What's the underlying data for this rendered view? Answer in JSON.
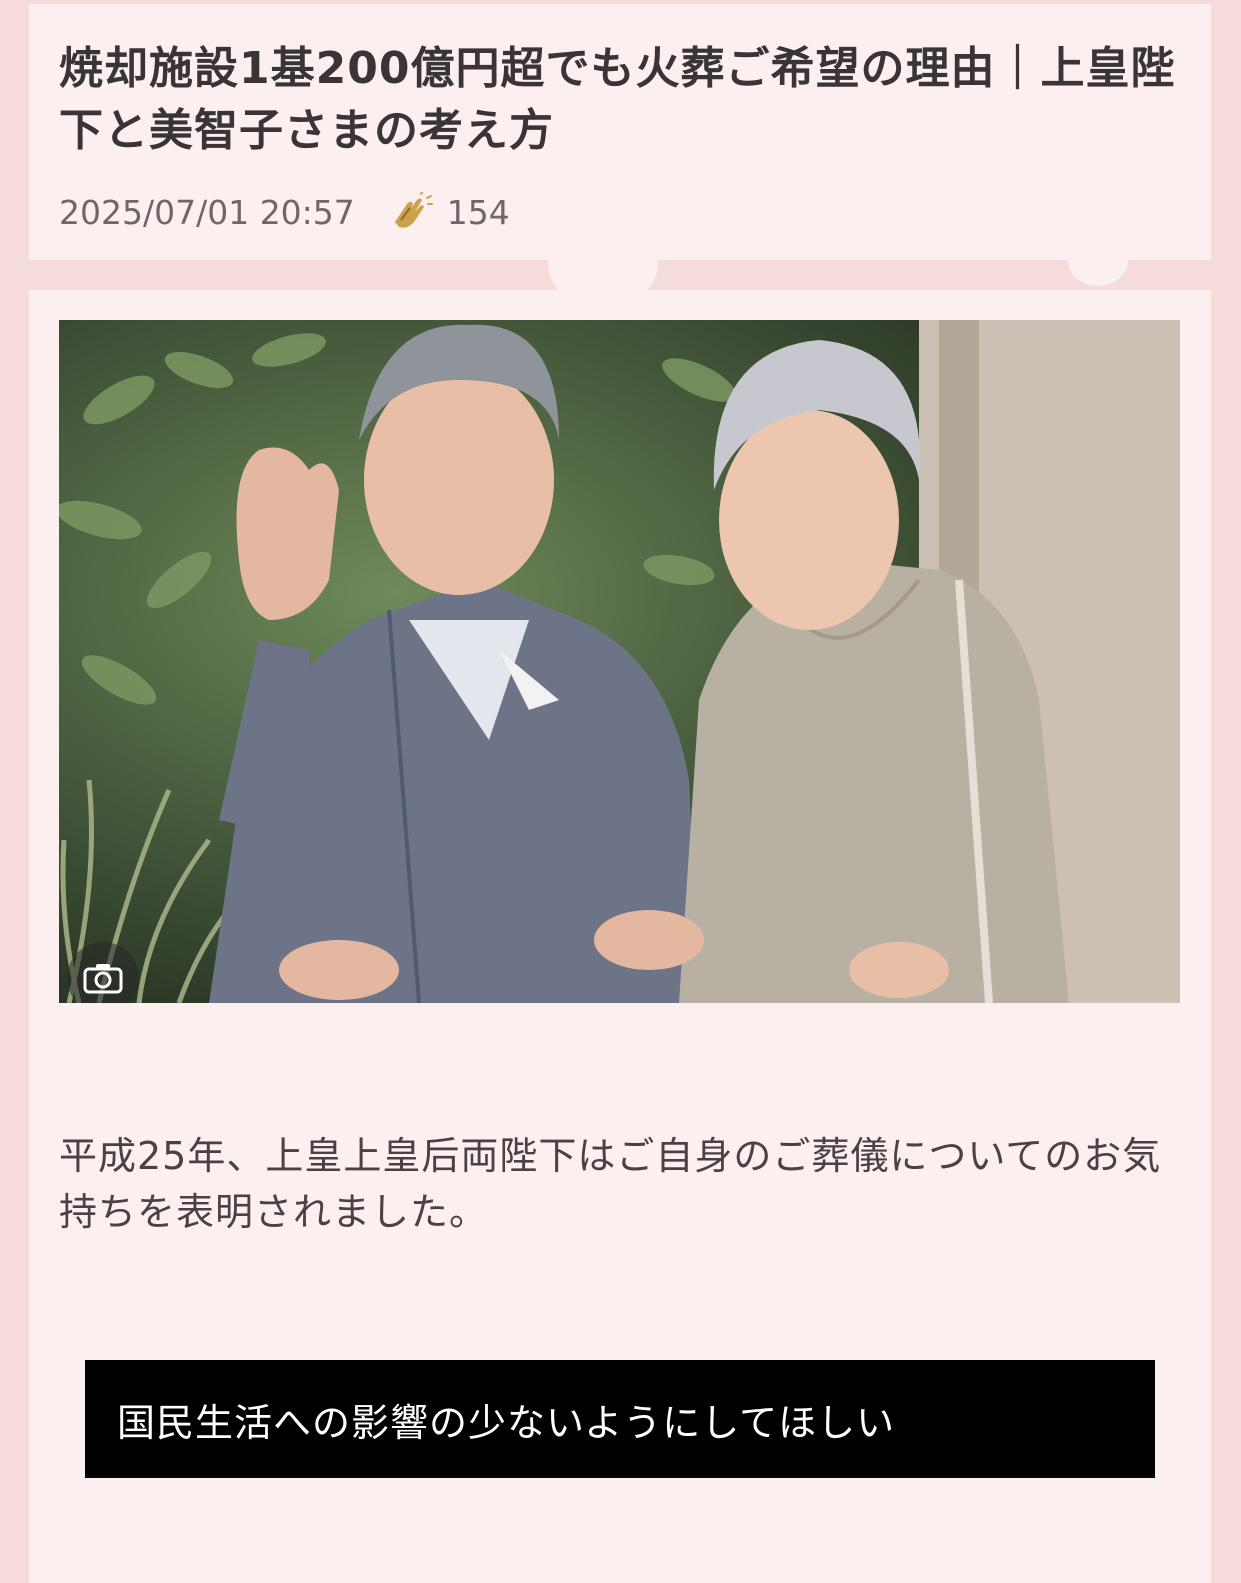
{
  "article": {
    "title": "焼却施設1基200億円超でも火葬ご希望の理由｜上皇陛下と美智子さまの考え方",
    "timestamp": "2025/07/01 20:57",
    "reaction_icon": "clapping-hands-icon",
    "reaction_count": "154",
    "photo_icon": "camera-icon",
    "lead_text": "平成25年、上皇上皇后両陛下はご自身のご葬儀についてのお気持ちを表明されました。",
    "quote_text": "国民生活への影響の少ないようにしてほしい"
  },
  "colors": {
    "page_background": "#f5dcdb",
    "card_background": "#fbeff0",
    "title_text": "#3a3434",
    "meta_text": "#6f6767",
    "clap_icon": "#c9a24a",
    "quote_background": "#000000",
    "quote_text": "#ffffff"
  }
}
